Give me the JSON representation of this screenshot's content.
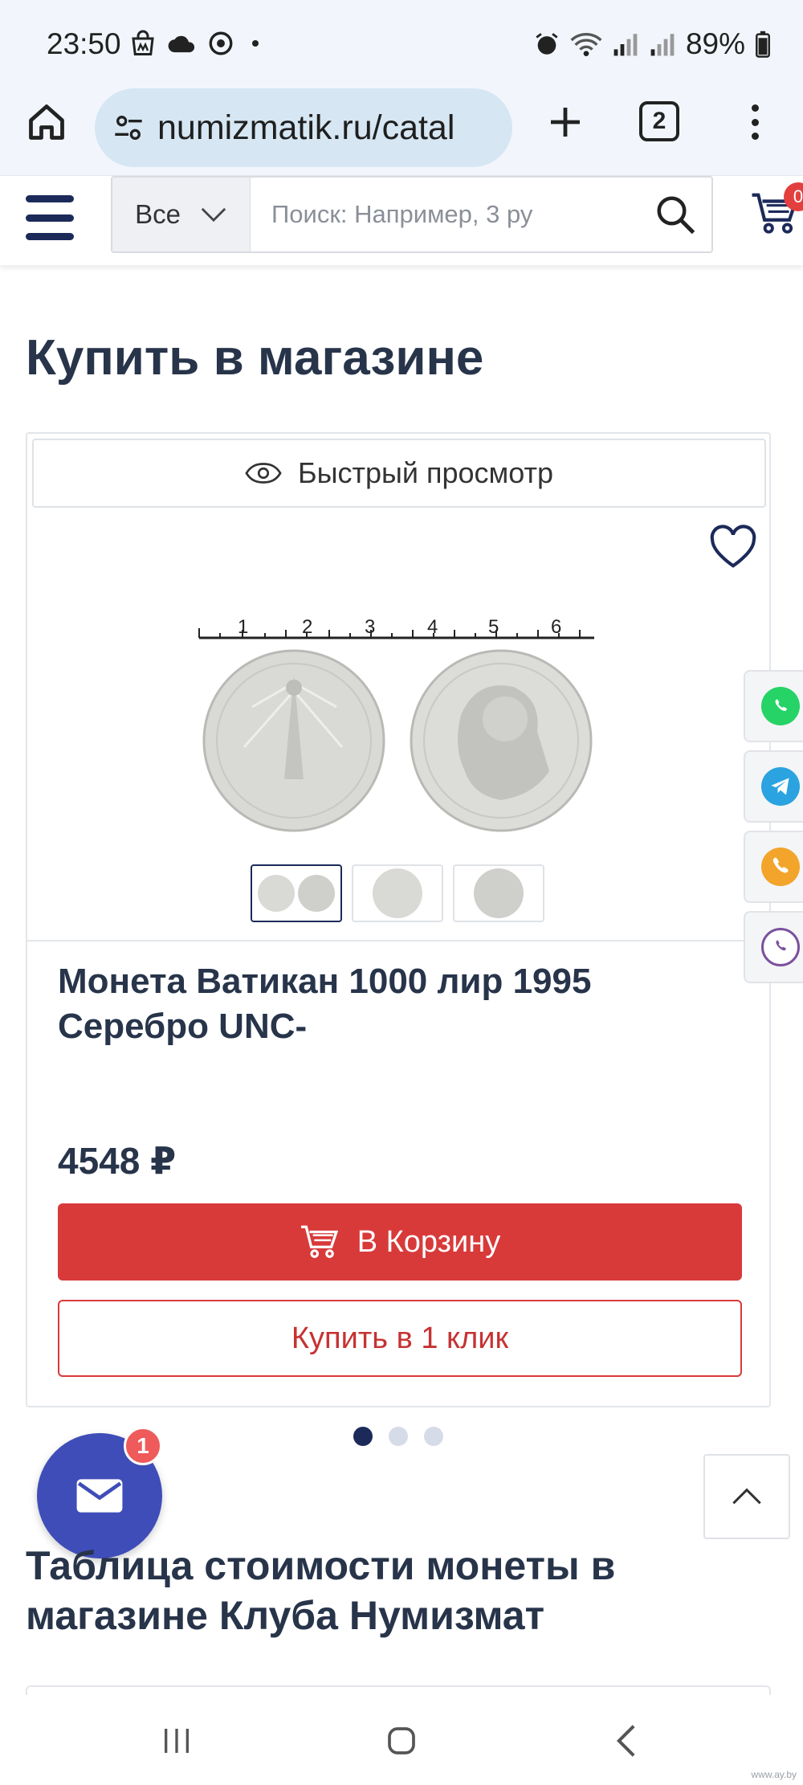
{
  "status_bar": {
    "time": "23:50",
    "battery": "89%"
  },
  "browser": {
    "url": "numizmatik.ru/catal",
    "tab_count": "2"
  },
  "header": {
    "search_category": "Все",
    "search_placeholder": "Поиск: Например, 3 ру",
    "cart_count": "0"
  },
  "page": {
    "section_title": "Купить в магазине",
    "product": {
      "quick_view_label": "Быстрый просмотр",
      "title": "Монета Ватикан 1000 лир 1995 Серебро UNC-",
      "price": "4548 ₽",
      "add_to_cart_label": "В Корзину",
      "buy_one_click_label": "Купить в 1 клик",
      "image_ruler": [
        "1",
        "2",
        "3",
        "4",
        "5",
        "6"
      ]
    },
    "chat_unread": "1",
    "table_title": "Таблица стоимости монеты в магазине Клуба Нумизмат"
  },
  "colors": {
    "brand_dark": "#1c2a5a",
    "accent_red": "#d83a3a",
    "chat_blue": "#3f4db8",
    "whatsapp": "#25d366",
    "telegram": "#2aa3e0",
    "phone": "#f2a52a",
    "viber": "#7b519d"
  },
  "watermark": "www.ay.by"
}
